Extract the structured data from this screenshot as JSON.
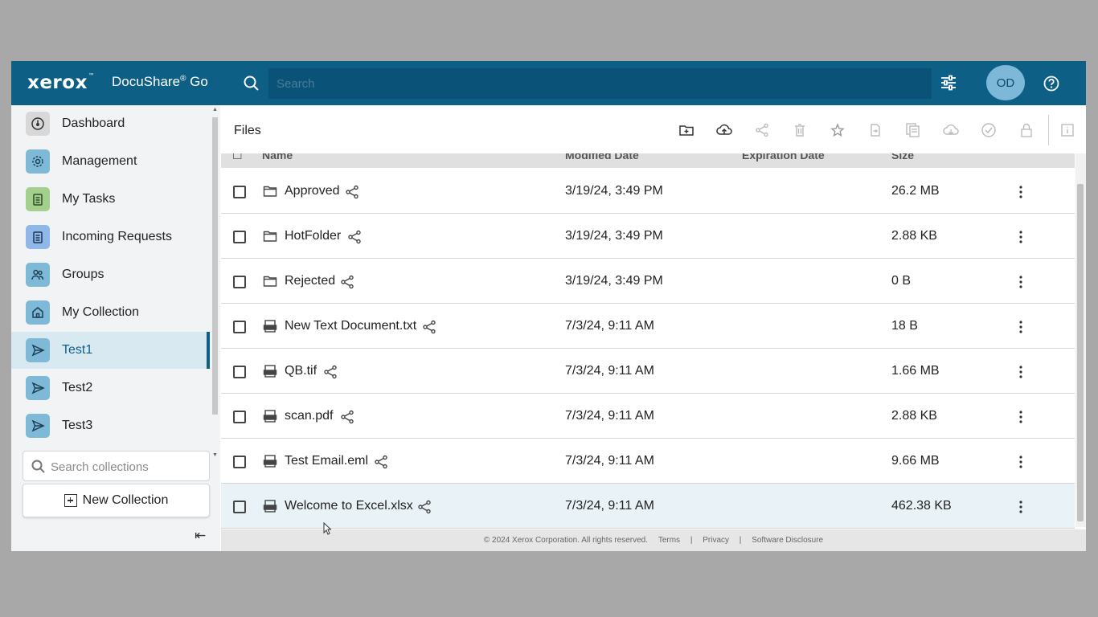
{
  "header": {
    "logo": "xerox",
    "logo_tm": "™",
    "product": "DocuShare",
    "product_reg": "®",
    "product_suffix": " Go",
    "search_placeholder": "Search",
    "avatar_initials": "OD",
    "header_color": "#0d5f86"
  },
  "sidebar": {
    "items": [
      {
        "label": "Dashboard",
        "icon": "dashboard-icon",
        "icon_bg": "#d8d8d8"
      },
      {
        "label": "Management",
        "icon": "gear-icon",
        "icon_bg": "#7fb9d8"
      },
      {
        "label": "My Tasks",
        "icon": "clipboard-icon",
        "icon_bg": "#a4d08e"
      },
      {
        "label": "Incoming Requests",
        "icon": "clipboard-icon",
        "icon_bg": "#8fb8e8"
      },
      {
        "label": "Groups",
        "icon": "people-icon",
        "icon_bg": "#7fb9d8"
      },
      {
        "label": "My Collection",
        "icon": "home-icon",
        "icon_bg": "#7fb9d8"
      },
      {
        "label": "Test1",
        "icon": "send-icon",
        "icon_bg": "#7fb9d8",
        "active": true
      },
      {
        "label": "Test2",
        "icon": "send-icon",
        "icon_bg": "#7fb9d8"
      },
      {
        "label": "Test3",
        "icon": "send-icon",
        "icon_bg": "#7fb9d8"
      }
    ],
    "collection_search_placeholder": "Search collections",
    "new_collection_label": "New Collection"
  },
  "main": {
    "title": "Files",
    "toolbar_icons": [
      "new-folder-icon",
      "upload-icon",
      "share-icon",
      "trash-icon",
      "star-icon",
      "file-move-icon",
      "copy-icon",
      "download-icon",
      "check-circle-icon",
      "lock-icon",
      "info-icon"
    ],
    "columns": {
      "name": "Name",
      "modified": "Modified Date",
      "expiration": "Expiration Date",
      "size": "Size"
    },
    "rows": [
      {
        "name": "Approved",
        "type": "folder",
        "modified": "3/19/24, 3:49 PM",
        "size": "26.2 MB"
      },
      {
        "name": "HotFolder",
        "type": "folder",
        "modified": "3/19/24, 3:49 PM",
        "size": "2.88 KB"
      },
      {
        "name": "Rejected",
        "type": "folder",
        "modified": "3/19/24, 3:49 PM",
        "size": "0 B"
      },
      {
        "name": "New Text Document.txt",
        "type": "file",
        "modified": "7/3/24, 9:11 AM",
        "size": "18 B"
      },
      {
        "name": "QB.tif",
        "type": "file",
        "modified": "7/3/24, 9:11 AM",
        "size": "1.66 MB"
      },
      {
        "name": "scan.pdf",
        "type": "file",
        "modified": "7/3/24, 9:11 AM",
        "size": "2.88 KB"
      },
      {
        "name": "Test Email.eml",
        "type": "file",
        "modified": "7/3/24, 9:11 AM",
        "size": "9.66 MB"
      },
      {
        "name": "Welcome to Excel.xlsx",
        "type": "file",
        "modified": "7/3/24, 9:11 AM",
        "size": "462.38 KB",
        "hover": true
      }
    ]
  },
  "footer": {
    "copyright": "© 2024 Xerox Corporation. All rights reserved.",
    "terms": "Terms",
    "sep1": "|",
    "privacy": "Privacy",
    "sep2": "|",
    "disclosure": "Software Disclosure"
  }
}
